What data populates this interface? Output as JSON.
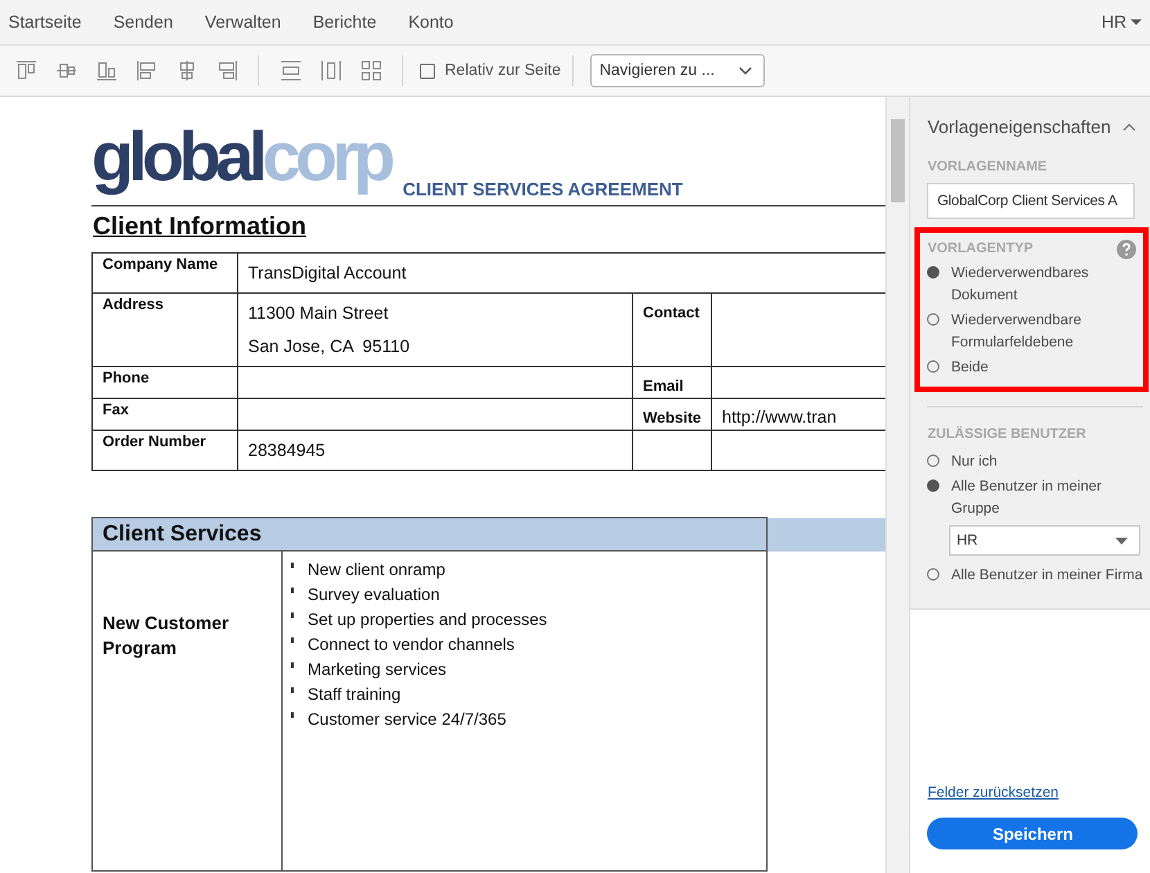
{
  "nav": {
    "items": [
      "Startseite",
      "Senden",
      "Verwalten",
      "Berichte",
      "Konto"
    ],
    "user": "HR"
  },
  "toolbar": {
    "relative_checkbox": {
      "label": "Relativ zur Seite",
      "checked": false
    },
    "navigate_dropdown": {
      "value": "Navigieren zu ..."
    }
  },
  "document": {
    "logo": {
      "part_1": "global",
      "part_2": "corp"
    },
    "title": "CLIENT SERVICES AGREEMENT",
    "section_title": "Client Information",
    "client_table": [
      {
        "kind": "wide",
        "label": "Company Name",
        "value": [
          "TransDigital Account"
        ]
      },
      {
        "kind": "split",
        "label": "Address",
        "value": [
          "11300 Main Street",
          "San Jose, CA  95110"
        ],
        "label_2": "Contact"
      },
      {
        "kind": "split",
        "label": "Phone",
        "label_2": "Email"
      },
      {
        "kind": "split",
        "label": "Fax",
        "label_2": "Website",
        "value_2": "http://www.tran"
      },
      {
        "kind": "split",
        "label": "Order Number",
        "value": [
          "28384945"
        ]
      }
    ],
    "services": {
      "title": "Client Services",
      "rows": [
        {
          "label": "New Customer Program",
          "items": [
            "New client onramp",
            "Survey evaluation",
            "Set up properties and processes",
            "Connect to vendor channels",
            "Marketing services",
            "Staff training",
            "Customer service 24/7/365"
          ]
        }
      ]
    }
  },
  "panel": {
    "title": "Vorlageneigenschaften",
    "name_label": "VORLAGENNAME",
    "name_value": "GlobalCorp Client Services A",
    "type_label": "VORLAGENTYP",
    "type_options": [
      {
        "label": "Wiederverwendbares Dokument",
        "selected": true
      },
      {
        "label": "Wiederverwendbare Formularfeldebene",
        "selected": false
      },
      {
        "label": "Beide",
        "selected": false
      }
    ],
    "users_label": "ZULÄSSIGE BENUTZER",
    "user_options": [
      {
        "label": "Nur ich",
        "selected": false
      },
      {
        "label": "Alle Benutzer in meiner Gruppe",
        "selected": true,
        "group": "HR"
      },
      {
        "label": "Alle Benutzer in meiner Firma",
        "selected": false
      }
    ],
    "reset_link": "Felder zurücksetzen",
    "save_button": "Speichern"
  }
}
